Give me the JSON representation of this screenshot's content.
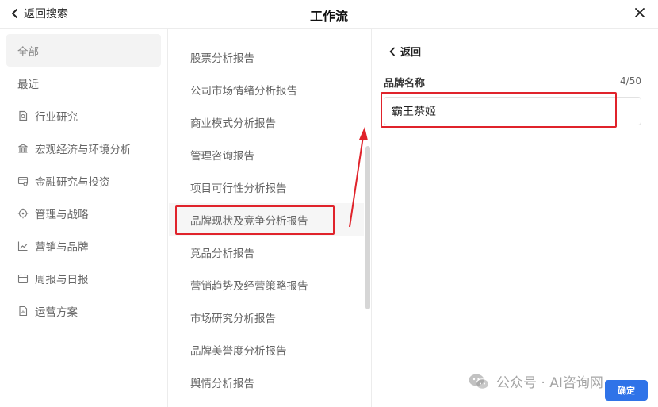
{
  "header": {
    "back_label": "返回搜索",
    "title": "工作流"
  },
  "sidebar": {
    "items": [
      {
        "label": "全部",
        "icon": "none",
        "active": true
      },
      {
        "label": "最近",
        "icon": "none"
      },
      {
        "label": "行业研究",
        "icon": "document-search-icon"
      },
      {
        "label": "宏观经济与环境分析",
        "icon": "bank-icon"
      },
      {
        "label": "金融研究与投资",
        "icon": "finance-card-icon"
      },
      {
        "label": "管理与战略",
        "icon": "target-icon"
      },
      {
        "label": "营销与品牌",
        "icon": "trend-chart-icon"
      },
      {
        "label": "周报与日报",
        "icon": "calendar-icon"
      },
      {
        "label": "运营方案",
        "icon": "report-icon"
      }
    ]
  },
  "templates": {
    "items": [
      "股票分析报告",
      "公司市场情绪分析报告",
      "商业模式分析报告",
      "管理咨询报告",
      "项目可行性分析报告",
      "品牌现状及竞争分析报告",
      "竞品分析报告",
      "营销趋势及经营策略报告",
      "市场研究分析报告",
      "品牌美誉度分析报告",
      "舆情分析报告"
    ],
    "selected_index": 5
  },
  "form": {
    "back_label": "返回",
    "field_label": "品牌名称",
    "counter": "4/50",
    "value": "霸王茶姬",
    "confirm_label": "确定"
  },
  "watermark": {
    "text": "公众号 · AI咨询网"
  },
  "colors": {
    "accent": "#2f73e8",
    "highlight": "#e0232b"
  }
}
